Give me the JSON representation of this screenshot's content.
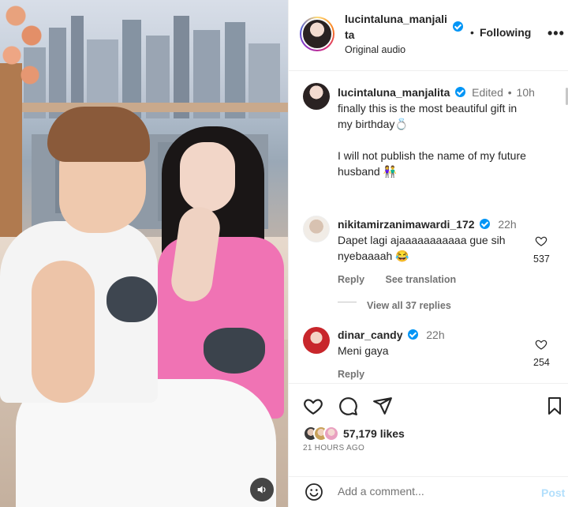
{
  "video": {
    "mute_icon": "speaker-icon"
  },
  "header": {
    "username": "lucintaluna_manjalita",
    "username_line1": "lucintaluna_manjali",
    "username_line2": "ta",
    "dot": "•",
    "follow_label": "Following",
    "audio": "Original audio",
    "more": "•••"
  },
  "caption": {
    "username": "lucintaluna_manjalita",
    "edited": "Edited",
    "sep": "•",
    "time": "10h",
    "line1": "finally this is the most beautiful gift in",
    "line2": "my birthday💍",
    "line3": "I will not publish the name of my future",
    "line4": "husband 👫"
  },
  "comments": [
    {
      "username": "nikitamirzanimawardi_172",
      "time": "22h",
      "text_line1": "Dapet lagi ajaaaaaaaaaaa gue sih",
      "text_line2": "nyebaaaah 😂",
      "reply": "Reply",
      "see_translation": "See translation",
      "likes": "537",
      "view_replies": "View all 37 replies"
    },
    {
      "username": "dinar_candy",
      "time": "22h",
      "text": "Meni gaya",
      "reply": "Reply",
      "likes": "254"
    }
  ],
  "actions": {
    "likes": "57,179 likes",
    "time_ago": "21 HOURS AGO"
  },
  "composer": {
    "placeholder": "Add a comment...",
    "post": "Post"
  },
  "colors": {
    "verified": "#0095f6",
    "text": "#262626",
    "muted": "#737373",
    "post_disabled": "#b2dffc"
  }
}
